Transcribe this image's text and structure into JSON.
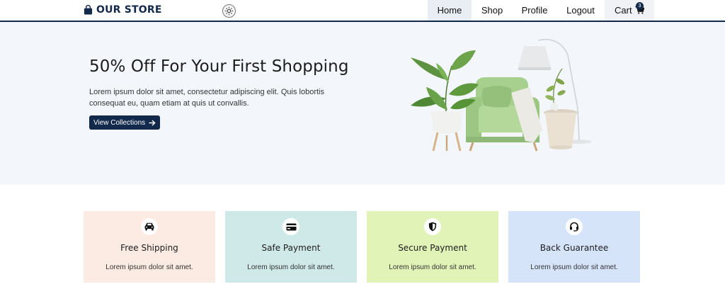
{
  "header": {
    "brand": "OUR STORE",
    "icons": {
      "brand": "shopping-bag-icon",
      "theme": "sun-icon"
    },
    "nav": [
      {
        "label": "Home",
        "active": true
      },
      {
        "label": "Shop",
        "active": false
      },
      {
        "label": "Profile",
        "active": false
      },
      {
        "label": "Logout",
        "active": false
      }
    ],
    "cart": {
      "label": "Cart",
      "count": "3",
      "icon": "cart-icon"
    }
  },
  "hero": {
    "title": "50% Off For Your First Shopping",
    "text": "Lorem ipsum dolor sit amet, consectetur adipiscing elit. Quis lobortis consequat eu, quam etiam at quis ut convallis.",
    "button": "View Collections",
    "button_icon": "arrow-right-icon",
    "image": "armchair-with-plants-and-lamp-image"
  },
  "features": [
    {
      "title": "Free Shipping",
      "text": "Lorem ipsum dolor sit amet.",
      "icon": "car-icon",
      "color": "#fcebe3"
    },
    {
      "title": "Safe Payment",
      "text": "Lorem ipsum dolor sit amet.",
      "icon": "credit-card-icon",
      "color": "#cfe9e8"
    },
    {
      "title": "Secure Payment",
      "text": "Lorem ipsum dolor sit amet.",
      "icon": "shield-icon",
      "color": "#e2f3b8"
    },
    {
      "title": "Back Guarantee",
      "text": "Lorem ipsum dolor sit amet.",
      "icon": "headset-icon",
      "color": "#d6e4fa"
    }
  ],
  "colors": {
    "primary": "#13294b",
    "hero_bg": "#f3f7fb"
  }
}
